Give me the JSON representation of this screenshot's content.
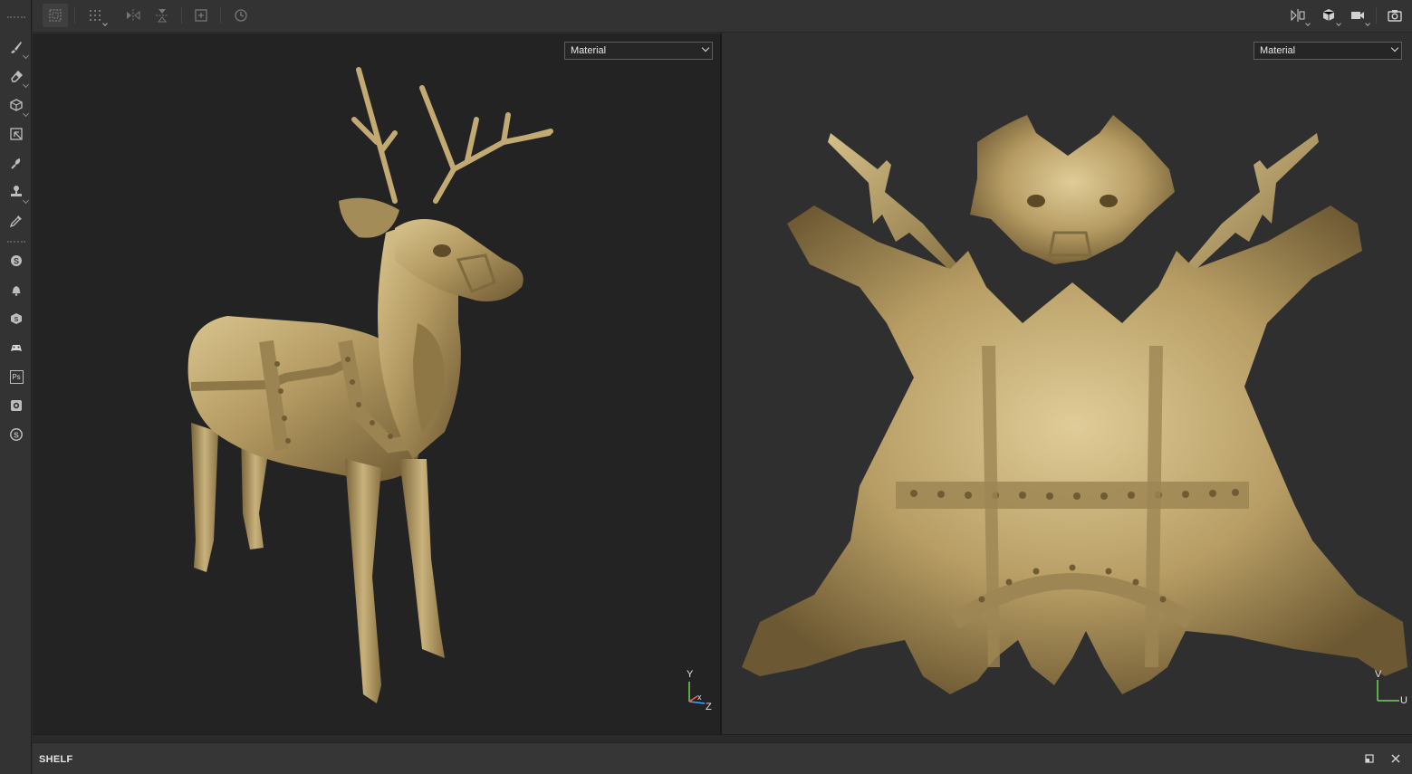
{
  "toolbar_left": {
    "tools": [
      {
        "name": "paint-brush-icon"
      },
      {
        "name": "eraser-icon"
      },
      {
        "name": "projection-icon"
      },
      {
        "name": "polygon-fill-icon"
      },
      {
        "name": "smudge-icon"
      },
      {
        "name": "clone-stamp-icon"
      },
      {
        "name": "color-picker-icon"
      },
      {
        "name": "substance-plugin-icon"
      },
      {
        "name": "bell-icon"
      },
      {
        "name": "substance-source-icon"
      },
      {
        "name": "gamepad-icon"
      },
      {
        "name": "photoshop-icon",
        "label": "Ps"
      },
      {
        "name": "camera-plugin-icon"
      },
      {
        "name": "substance-share-icon"
      }
    ]
  },
  "toolbar_top": {
    "left_tools": [
      "selection-mode-icon",
      "grid-select-icon",
      "mirror-x-icon",
      "mirror-y-icon",
      "add-layer-icon",
      "history-icon"
    ],
    "right_tools": [
      "split-view-icon",
      "cube-view-icon",
      "camera-icon",
      "screenshot-icon"
    ]
  },
  "viewport_3d": {
    "channel_select": "Material",
    "axis": {
      "y": "Y",
      "x": "x",
      "z": "Z"
    }
  },
  "viewport_2d": {
    "channel_select": "Material",
    "axis": {
      "v": "V",
      "u": "U"
    }
  },
  "shelf": {
    "title": "SHELF"
  },
  "colors": {
    "background_dark": "#232323",
    "panel": "#333333",
    "model_gold": "#b9a06a"
  }
}
